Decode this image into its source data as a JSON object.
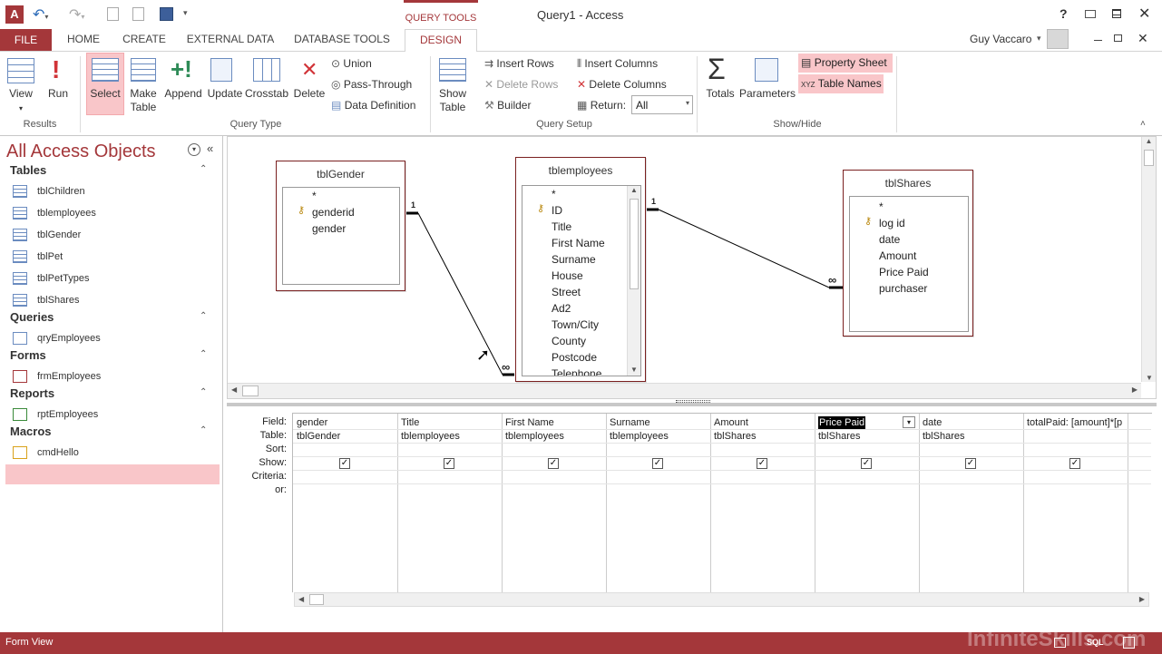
{
  "window": {
    "title": "Query1 - Access",
    "context_tab": "QUERY TOOLS",
    "user": "Guy Vaccaro",
    "help": "?"
  },
  "tabs": [
    "FILE",
    "HOME",
    "CREATE",
    "EXTERNAL DATA",
    "DATABASE TOOLS",
    "DESIGN"
  ],
  "ribbon": {
    "results": {
      "group": "Results",
      "view": "View",
      "run": "Run"
    },
    "query_type": {
      "group": "Query Type",
      "select": "Select",
      "make_table_1": "Make",
      "make_table_2": "Table",
      "append": "Append",
      "update": "Update",
      "crosstab": "Crosstab",
      "delete": "Delete",
      "union": "Union",
      "pass_through": "Pass-Through",
      "data_definition": "Data Definition"
    },
    "query_setup": {
      "group": "Query Setup",
      "show_table_1": "Show",
      "show_table_2": "Table",
      "insert_rows": "Insert Rows",
      "delete_rows": "Delete Rows",
      "builder": "Builder",
      "insert_columns": "Insert Columns",
      "delete_columns": "Delete Columns",
      "return_label": "Return:",
      "return_value": "All"
    },
    "show_hide": {
      "group": "Show/Hide",
      "totals": "Totals",
      "parameters": "Parameters",
      "property_sheet": "Property Sheet",
      "table_names": "Table Names"
    }
  },
  "nav": {
    "title": "All Access Objects",
    "sections": [
      {
        "name": "Tables",
        "items": [
          "tblChildren",
          "tblemployees",
          "tblGender",
          "tblPet",
          "tblPetTypes",
          "tblShares"
        ]
      },
      {
        "name": "Queries",
        "items": [
          "qryEmployees"
        ]
      },
      {
        "name": "Forms",
        "items": [
          "frmEmployees"
        ]
      },
      {
        "name": "Reports",
        "items": [
          "rptEmployees"
        ]
      },
      {
        "name": "Macros",
        "items": [
          "cmdHello"
        ]
      }
    ]
  },
  "tables": {
    "gender": {
      "name": "tblGender",
      "fields": [
        "*",
        "genderid",
        "gender"
      ]
    },
    "employees": {
      "name": "tblemployees",
      "fields": [
        "*",
        "ID",
        "Title",
        "First Name",
        "Surname",
        "House",
        "Street",
        "Ad2",
        "Town/City",
        "County",
        "Postcode",
        "Telephone"
      ]
    },
    "shares": {
      "name": "tblShares",
      "fields": [
        "*",
        "log id",
        "date",
        "Amount",
        "Price Paid",
        "purchaser"
      ]
    }
  },
  "relations": {
    "one": "1",
    "many": "∞"
  },
  "grid": {
    "row_labels": [
      "Field:",
      "Table:",
      "Sort:",
      "Show:",
      "Criteria:",
      "or:"
    ],
    "columns": [
      {
        "field": "gender",
        "table": "tblGender",
        "show": true
      },
      {
        "field": "Title",
        "table": "tblemployees",
        "show": true
      },
      {
        "field": "First Name",
        "table": "tblemployees",
        "show": true
      },
      {
        "field": "Surname",
        "table": "tblemployees",
        "show": true
      },
      {
        "field": "Amount",
        "table": "tblShares",
        "show": true
      },
      {
        "field": "Price Paid",
        "table": "tblShares",
        "show": true
      },
      {
        "field": "date",
        "table": "tblShares",
        "show": true
      },
      {
        "field": "totalPaid: [amount]*[p",
        "table": "",
        "show": true
      }
    ]
  },
  "status": {
    "left": "Form View",
    "sql": "SQL",
    "watermark": "InfiniteSkills.com"
  },
  "colors": {
    "accent": "#a4373a",
    "brand": "#a4373a",
    "highlight": "#f9c6c9"
  }
}
